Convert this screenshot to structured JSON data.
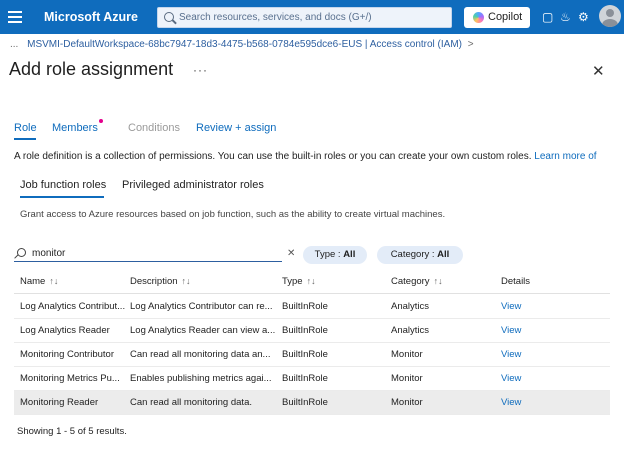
{
  "topbar": {
    "brand": "Microsoft Azure",
    "search_placeholder": "Search resources, services, and docs (G+/)",
    "copilot_label": "Copilot",
    "brand_color": "#0f6cbd"
  },
  "breadcrumb": {
    "ellipsis": "...",
    "item": "MSVMI-DefaultWorkspace-68bc7947-18d3-4475-b568-0784e595dce6-EUS | Access control (IAM)",
    "chevron": ">"
  },
  "page": {
    "title": "Add role assignment",
    "more": "···",
    "close": "✕"
  },
  "tabs": [
    {
      "label": "Role"
    },
    {
      "label": "Members"
    },
    {
      "label": "Conditions"
    },
    {
      "label": "Review + assign"
    }
  ],
  "description": {
    "text": "A role definition is a collection of permissions. You can use the built-in roles or you can create your own custom roles. ",
    "link": "Learn more of"
  },
  "subtabs": [
    {
      "label": "Job function roles"
    },
    {
      "label": "Privileged administrator roles"
    }
  ],
  "grant_text": "Grant access to Azure resources based on job function, such as the ability to create virtual machines.",
  "filter": {
    "value": "monitor",
    "clear": "✕"
  },
  "pills": {
    "type_label": "Type : ",
    "type_value": "All",
    "category_label": "Category : ",
    "category_value": "All"
  },
  "table": {
    "headers": {
      "name": "Name",
      "description": "Description",
      "type": "Type",
      "category": "Category",
      "details": "Details",
      "sort_icon": "↑↓"
    },
    "rows": [
      {
        "name": "Log Analytics Contribut...",
        "description": "Log Analytics Contributor can re...",
        "type": "BuiltInRole",
        "category": "Analytics",
        "details": "View"
      },
      {
        "name": "Log Analytics Reader",
        "description": "Log Analytics Reader can view a...",
        "type": "BuiltInRole",
        "category": "Analytics",
        "details": "View"
      },
      {
        "name": "Monitoring Contributor",
        "description": "Can read all monitoring data an...",
        "type": "BuiltInRole",
        "category": "Monitor",
        "details": "View"
      },
      {
        "name": "Monitoring Metrics Pu...",
        "description": "Enables publishing metrics agai...",
        "type": "BuiltInRole",
        "category": "Monitor",
        "details": "View"
      },
      {
        "name": "Monitoring Reader",
        "description": "Can read all monitoring data.",
        "type": "BuiltInRole",
        "category": "Monitor",
        "details": "View"
      }
    ],
    "selected_index": 4
  },
  "footer": {
    "text": "Showing 1 - 5 of 5 results."
  }
}
